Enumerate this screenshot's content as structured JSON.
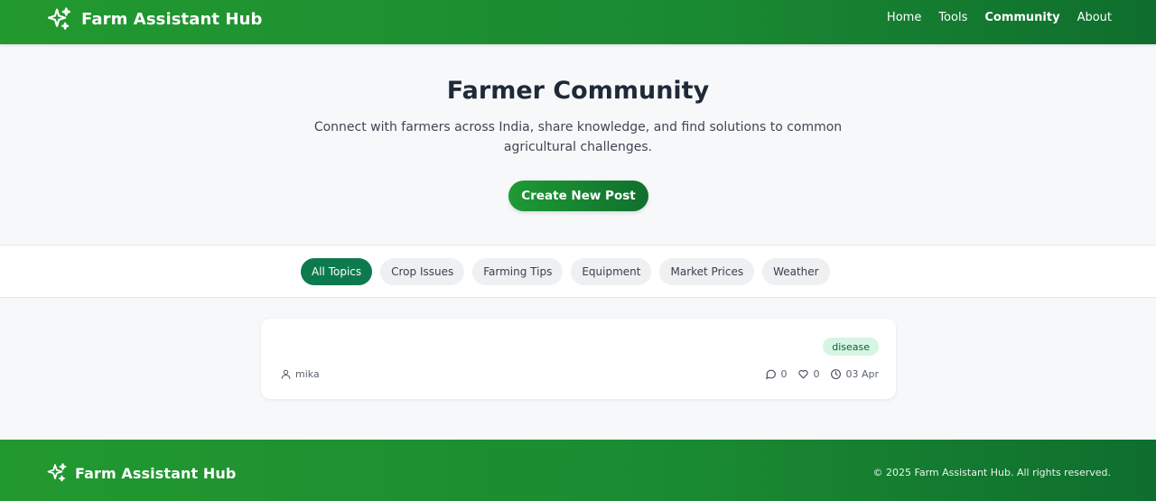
{
  "header": {
    "brand": "Farm Assistant Hub",
    "nav": [
      {
        "label": "Home",
        "active": false
      },
      {
        "label": "Tools",
        "active": false
      },
      {
        "label": "Community",
        "active": true
      },
      {
        "label": "About",
        "active": false
      }
    ]
  },
  "hero": {
    "title": "Farmer Community",
    "description": "Connect with farmers across India, share knowledge, and find solutions to common agricultural challenges.",
    "cta_label": "Create New Post"
  },
  "filters": [
    {
      "label": "All Topics",
      "active": true
    },
    {
      "label": "Crop Issues",
      "active": false
    },
    {
      "label": "Farming Tips",
      "active": false
    },
    {
      "label": "Equipment",
      "active": false
    },
    {
      "label": "Market Prices",
      "active": false
    },
    {
      "label": "Weather",
      "active": false
    }
  ],
  "posts": [
    {
      "tag": "disease",
      "author": "mika",
      "comments": "0",
      "likes": "0",
      "date": "03 Apr"
    }
  ],
  "footer": {
    "brand": "Farm Assistant Hub",
    "copyright": "© 2025 Farm Assistant Hub. All rights reserved."
  },
  "colors": {
    "brand_green": "#1a8a32",
    "active_chip": "#0d7a4e",
    "tag_bg": "#d7f5e4"
  },
  "icons": {
    "logo": "sparkles-icon",
    "author": "user-icon",
    "comments": "message-circle-icon",
    "likes": "heart-icon",
    "date": "clock-icon"
  }
}
